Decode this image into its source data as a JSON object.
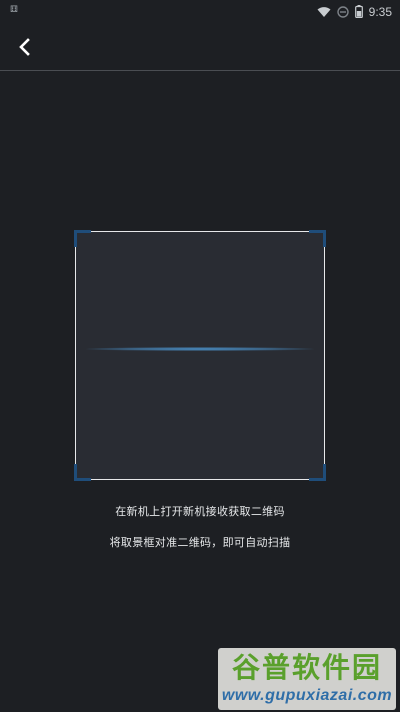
{
  "status_bar": {
    "notification": "⚅",
    "time": "9:35",
    "icons": [
      "wifi-icon",
      "dnd-icon",
      "battery-icon"
    ]
  },
  "toolbar": {
    "back_icon": "chevron-left-icon"
  },
  "scanner": {
    "frame_color": "#e6e8ea",
    "corner_color": "#1f4d7a",
    "line_color": "#4a90c8"
  },
  "hints": {
    "line1": "在新机上打开新机接收获取二维码",
    "line2": "将取景框对准二维码，即可自动扫描"
  },
  "watermark": {
    "title": "谷普软件园",
    "url": "www.gupuxiazai.com"
  },
  "colors": {
    "background": "#1d1f23",
    "frame_fill": "#292c33"
  }
}
